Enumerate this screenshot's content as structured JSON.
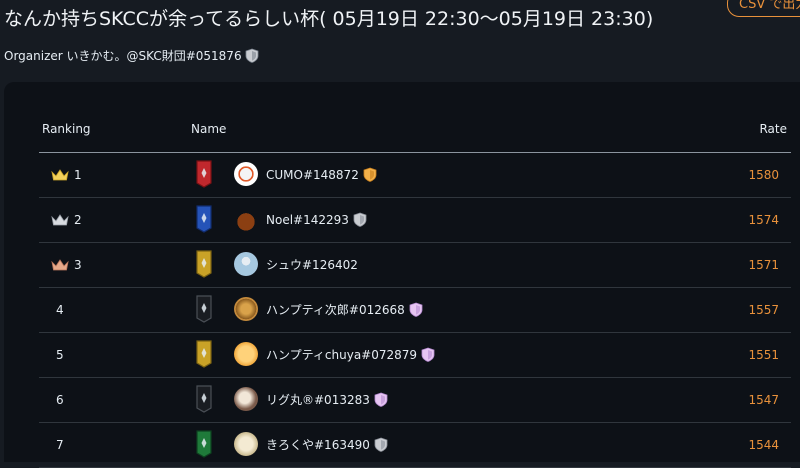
{
  "header": {
    "title": "なんか持ちSKCCが余ってるらしい杯( 05月19日 22:30〜05月19日 23:30)",
    "csv_button": "CSV で出力",
    "organizer": "Organizer いきかむ。@SKC財団#051876"
  },
  "table": {
    "columns": {
      "ranking": "Ranking",
      "name": "Name",
      "rate": "Rate"
    },
    "rows": [
      {
        "rank": "1",
        "name": "CUMO#148872",
        "rate": "1580",
        "crown": "gold",
        "banner": "red",
        "badge": "gold-shield"
      },
      {
        "rank": "2",
        "name": "Noel#142293",
        "rate": "1574",
        "crown": "silver",
        "banner": "blue",
        "badge": "silver-shield"
      },
      {
        "rank": "3",
        "name": "シュウ#126402",
        "rate": "1571",
        "crown": "bronze",
        "banner": "gold",
        "badge": ""
      },
      {
        "rank": "4",
        "name": "ハンプティ次郎#012668",
        "rate": "1557",
        "crown": "",
        "banner": "black",
        "badge": "pink-shield"
      },
      {
        "rank": "5",
        "name": "ハンプティchuya#072879",
        "rate": "1551",
        "crown": "",
        "banner": "gold",
        "badge": "pink-shield"
      },
      {
        "rank": "6",
        "name": "リグ丸®#013283",
        "rate": "1547",
        "crown": "",
        "banner": "black",
        "badge": "pink-shield"
      },
      {
        "rank": "7",
        "name": "きろくや#163490",
        "rate": "1544",
        "crown": "",
        "banner": "green",
        "badge": "silver-shield"
      }
    ]
  },
  "colors": {
    "accent": "#e8913b",
    "panel_bg": "#0d1117",
    "page_bg": "#161b22"
  }
}
